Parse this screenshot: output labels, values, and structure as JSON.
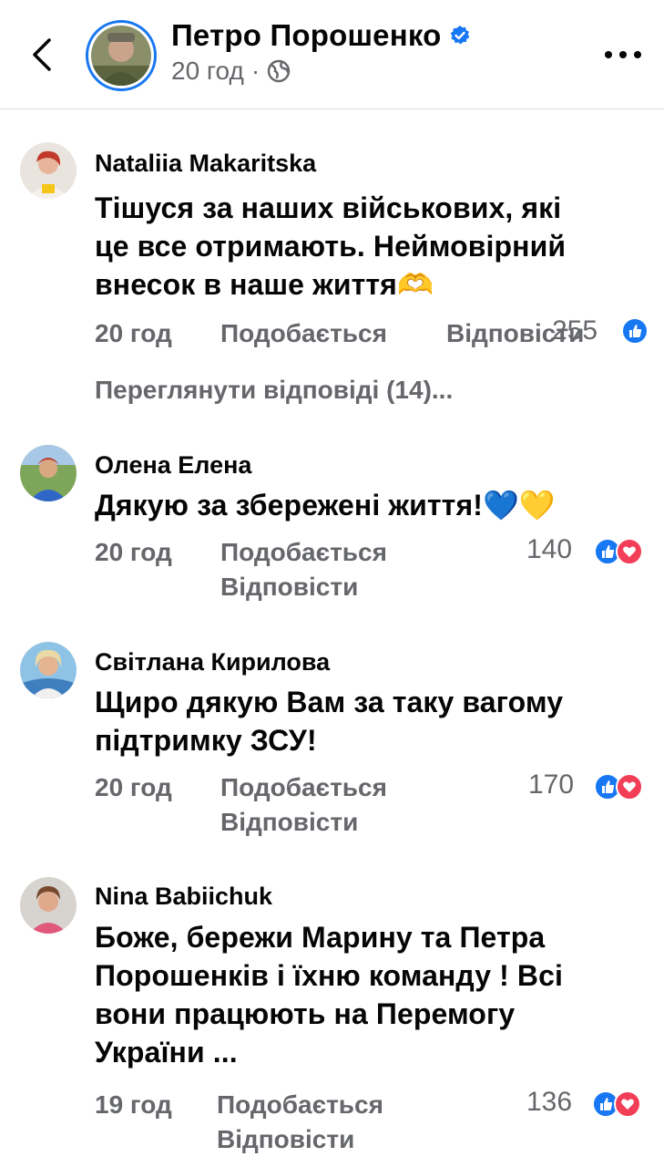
{
  "header": {
    "page_name": "Петро Порошенко",
    "time": "20 год",
    "separator": "·",
    "icons": {
      "back": "chevron-left-icon",
      "verified": "verified-badge-icon",
      "audience": "globe-icon",
      "more": "more-dots-icon"
    }
  },
  "colors": {
    "accent": "#1877f2",
    "love": "#f33e58",
    "meta": "#65676b",
    "text": "#050505"
  },
  "comments": [
    {
      "author": "Nataliia Makaritska",
      "lines": [
        "Тішуся за наших військових, які",
        "це все отримають. Неймовірний",
        "внесок в наше життя🫶"
      ],
      "time": "20 год",
      "like": "Подобається",
      "reply": "Відповісти",
      "reaction_count": "255",
      "reactions": [
        "like"
      ],
      "view_replies": "Переглянути відповіді (14)..."
    },
    {
      "author": "Олена Елена",
      "lines": [
        "Дякую за збережені життя!💙💛"
      ],
      "time": "20 год",
      "like": "Подобається",
      "reply": "Відповісти",
      "reaction_count": "140",
      "reactions": [
        "like",
        "love"
      ]
    },
    {
      "author": "Світлана Кирилова",
      "lines": [
        "Щиро дякую Вам за таку вагому",
        "підтримку ЗСУ!"
      ],
      "time": "20 год",
      "like": "Подобається",
      "reply": "Відповісти",
      "reaction_count": "170",
      "reactions": [
        "like",
        "love"
      ]
    },
    {
      "author": "Nina Babiichuk",
      "lines": [
        "Боже, бережи Марину та Петра",
        "Порошенків і їхню команду ! Всі",
        "вони працюють на Перемогу",
        "України ..."
      ],
      "time": "19 год",
      "like": "Подобається",
      "reply": "Відповісти",
      "reaction_count": "136",
      "reactions": [
        "like",
        "love"
      ]
    }
  ]
}
